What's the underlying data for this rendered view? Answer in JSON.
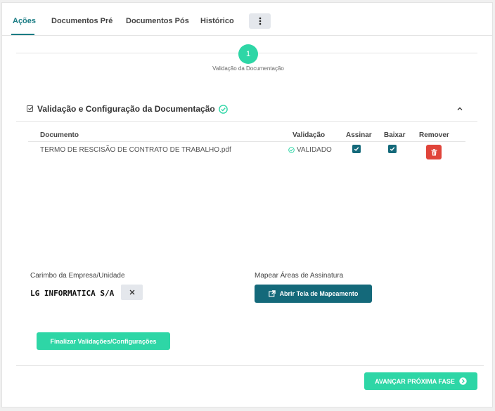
{
  "tabs": [
    {
      "label": "Ações"
    },
    {
      "label": "Documentos Pré"
    },
    {
      "label": "Documentos Pós"
    },
    {
      "label": "Histórico"
    }
  ],
  "stepper": {
    "step_number": "1",
    "step_label": "Validação da Documentação"
  },
  "section": {
    "title": "Validação e Configuração da Documentação"
  },
  "table": {
    "headers": {
      "document": "Documento",
      "validation": "Validação",
      "sign": "Assinar",
      "download": "Baixar",
      "remove": "Remover"
    },
    "rows": [
      {
        "document": "TERMO DE RESCISÃO DE CONTRATO DE TRABALHO.pdf",
        "validation": "VALIDADO",
        "sign": true,
        "download": true
      }
    ]
  },
  "stamp": {
    "label": "Carimbo da Empresa/Unidade",
    "value": "LG INFORMATICA S/A"
  },
  "mapping": {
    "label": "Mapear Áreas de Assinatura",
    "button": "Abrir Tela de Mapeamento"
  },
  "buttons": {
    "finish": "Finalizar Validações/Configurações",
    "next_phase": "AVANÇAR PRÓXIMA FASE"
  },
  "colors": {
    "teal": "#14697a",
    "green": "#2ed6a6",
    "red": "#e0443a",
    "active_tab": "#1a7c84"
  }
}
